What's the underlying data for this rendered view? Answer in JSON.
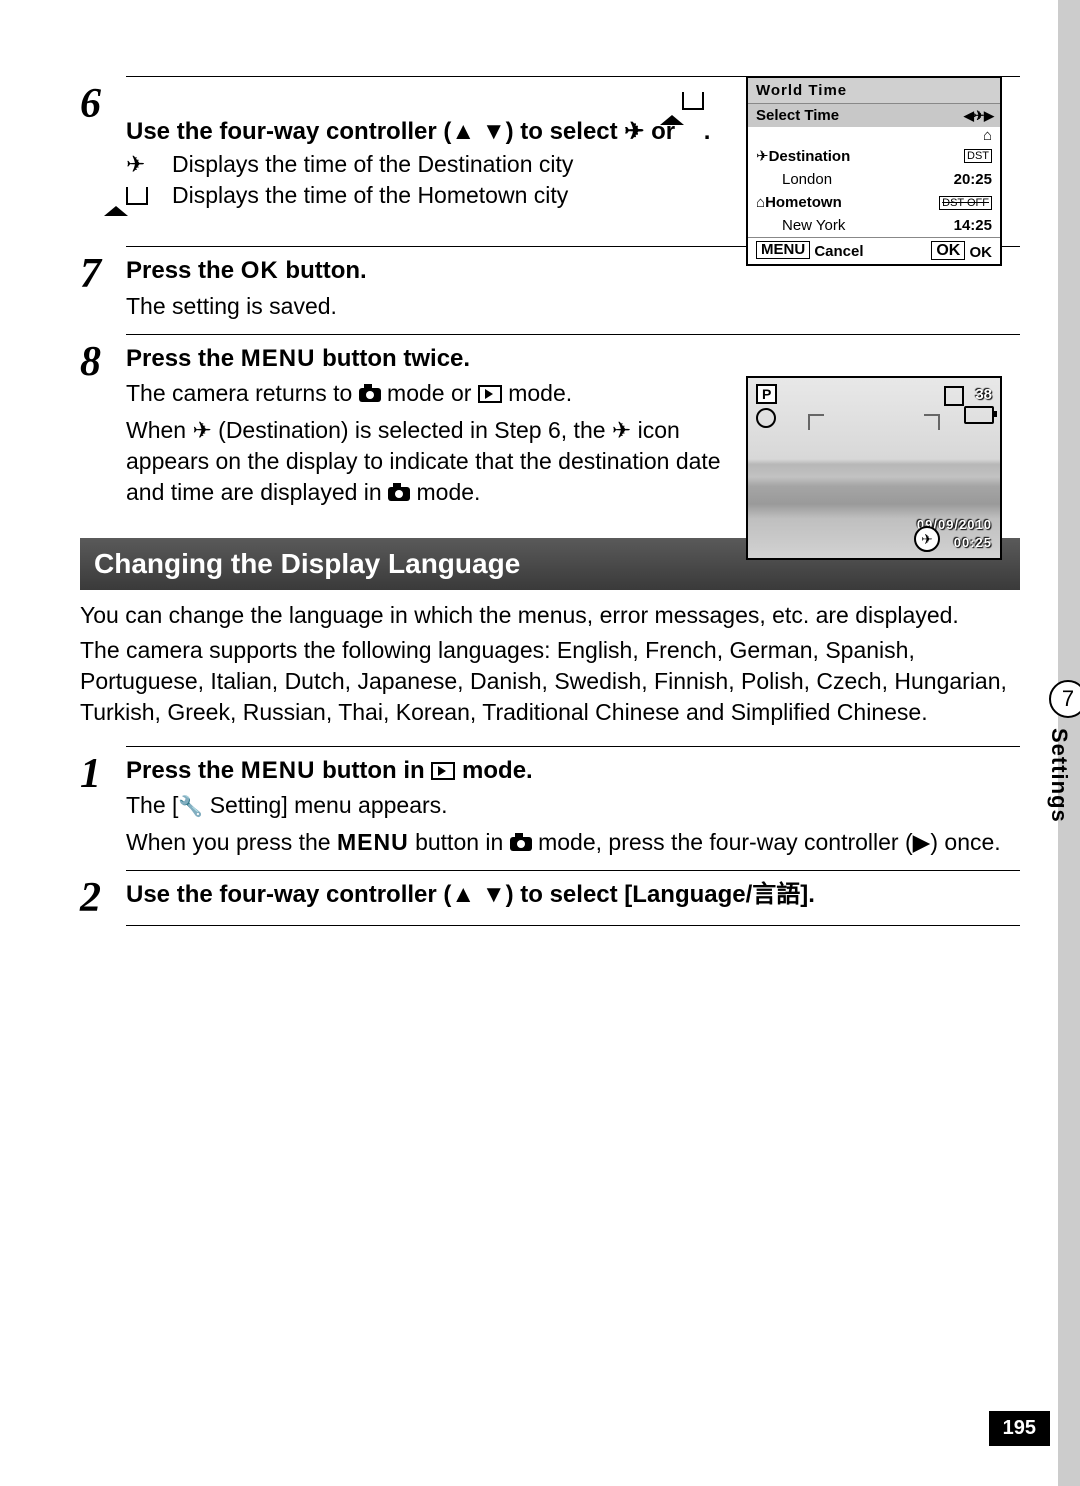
{
  "page_number": "195",
  "side_tab": {
    "number": "7",
    "label": "Settings"
  },
  "step6": {
    "num": "6",
    "head_a": "Use the four-way controller (",
    "head_b": ") to select ",
    "head_c": " or ",
    "head_d": ".",
    "plane_desc": "Displays the time of the Destination city",
    "home_desc": "Displays the time of the Hometown city"
  },
  "step7": {
    "num": "7",
    "head_a": "Press the ",
    "head_b": " button.",
    "ok_label": "OK",
    "text": "The setting is saved."
  },
  "step8": {
    "num": "8",
    "head_a": "Press the ",
    "head_b": " button twice.",
    "menu_label": "MENU",
    "p1_a": "The camera returns to ",
    "p1_b": " mode or ",
    "p1_c": " mode.",
    "p2_a": "When ",
    "p2_b": " (Destination) is selected in Step 6, the ",
    "p2_c": " icon appears on the display to indicate that the destination date and time are displayed in ",
    "p2_d": " mode."
  },
  "section_title": "Changing the Display Language",
  "lang_intro": "You can change the language in which the menus, error messages, etc. are displayed.",
  "lang_list": "The camera supports the following languages: English, French, German, Spanish, Portuguese, Italian, Dutch, Japanese, Danish, Swedish, Finnish, Polish, Czech, Hungarian, Turkish, Greek, Russian, Thai, Korean, Traditional Chinese and Simplified Chinese.",
  "lstep1": {
    "num": "1",
    "head_a": "Press the ",
    "head_b": " button in ",
    "head_c": " mode.",
    "menu_label": "MENU",
    "p1_a": "The [",
    "p1_b": " Setting] menu appears.",
    "p2_a": "When you press the ",
    "p2_b": " button in ",
    "p2_c": " mode, press the four-way controller (",
    "p2_d": ") once."
  },
  "lstep2": {
    "num": "2",
    "head_a": "Use the four-way controller (",
    "head_b": ") to select [Language/言語]."
  },
  "worldtime": {
    "title": "World Time",
    "select": "Select Time",
    "dest_label": "Destination",
    "dest_city": "London",
    "dest_time": "20:25",
    "home_label": "Hometown",
    "home_city": "New York",
    "home_time": "14:25",
    "dst_on": "DST",
    "dst_off": "DST OFF",
    "cancel": "Cancel",
    "ok": "OK",
    "menu": "MENU"
  },
  "preview": {
    "mode": "P",
    "count": "38",
    "date": "09/09/2010",
    "time": "00:25"
  }
}
